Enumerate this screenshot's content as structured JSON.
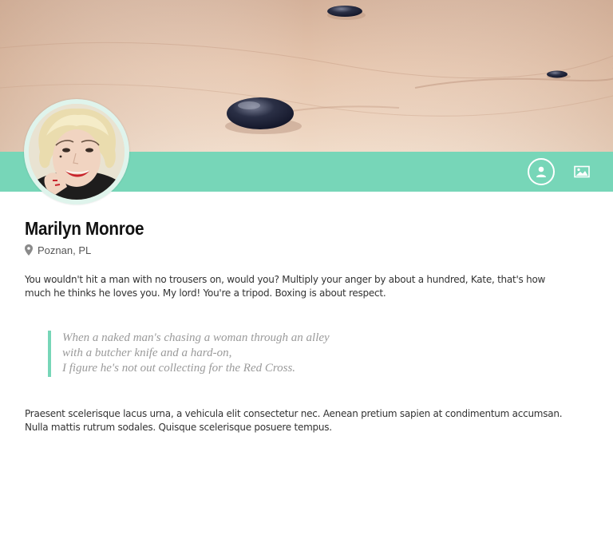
{
  "profile": {
    "name": "Marilyn Monroe",
    "location": "Poznan, PL"
  },
  "content": {
    "intro": "You wouldn't hit a man with no trousers on, would you? Multiply your anger by about a hundred, Kate, that's how much he thinks he loves you. My lord! You're a tripod. Boxing is about respect.",
    "quote_lines": [
      "When a naked man's chasing a woman through an alley",
      "with a butcher knife and a hard-on,",
      "I figure he's not out collecting for the Red Cross."
    ],
    "outro": "Praesent scelerisque lacus urna, a vehicula elit consectetur nec. Aenean pretium sapien at condimentum accumsan. Nulla mattis rutrum sodales. Quisque scelerisque posuere tempus."
  },
  "toolbar": {
    "icons": [
      "user-profile-icon",
      "image-gallery-icon"
    ]
  },
  "theme": {
    "accent": "#77d6b8",
    "quote_text": "#9a9a9a",
    "body_text": "#333333"
  }
}
